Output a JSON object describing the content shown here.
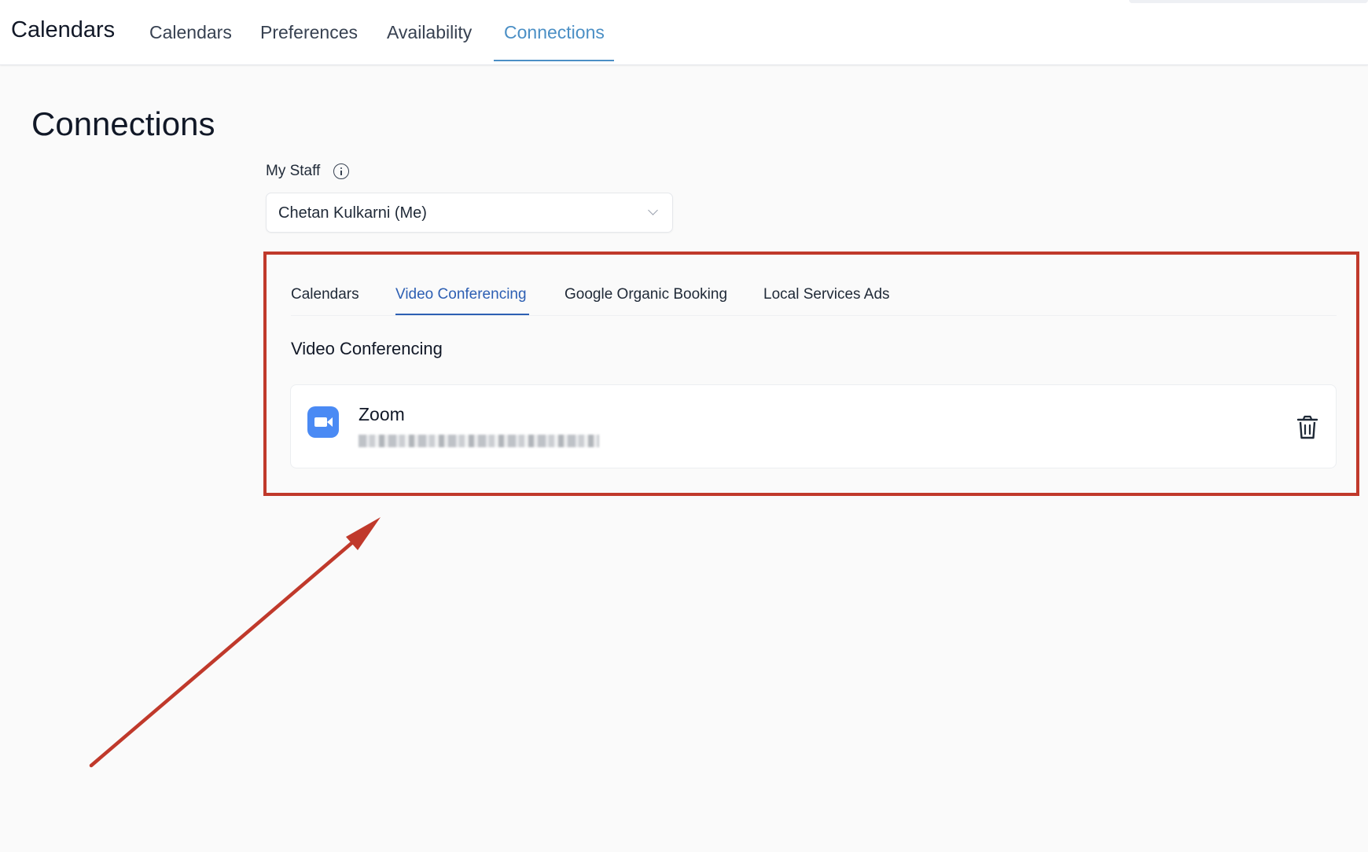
{
  "app": {
    "title": "Calendars"
  },
  "top_nav": {
    "tabs": [
      {
        "label": "Calendars"
      },
      {
        "label": "Preferences"
      },
      {
        "label": "Availability"
      },
      {
        "label": "Connections",
        "active": true
      }
    ]
  },
  "page": {
    "title": "Connections"
  },
  "staff": {
    "label": "My Staff",
    "selected": "Chetan Kulkarni (Me)"
  },
  "sub_tabs": [
    {
      "label": "Calendars"
    },
    {
      "label": "Video Conferencing",
      "active": true
    },
    {
      "label": "Google Organic Booking"
    },
    {
      "label": "Local Services Ads"
    }
  ],
  "section": {
    "title": "Video Conferencing",
    "connection": {
      "name": "Zoom",
      "account": "(blurred email)"
    }
  },
  "colors": {
    "accent_top": "#4b8fc5",
    "accent_sub": "#2d5fb3",
    "annotation": "#c0392b",
    "zoom_brand": "#4a8af4"
  },
  "icons": [
    "info-icon",
    "chevron-down-icon",
    "zoom-video-icon",
    "trash-icon",
    "annotation-arrow"
  ]
}
